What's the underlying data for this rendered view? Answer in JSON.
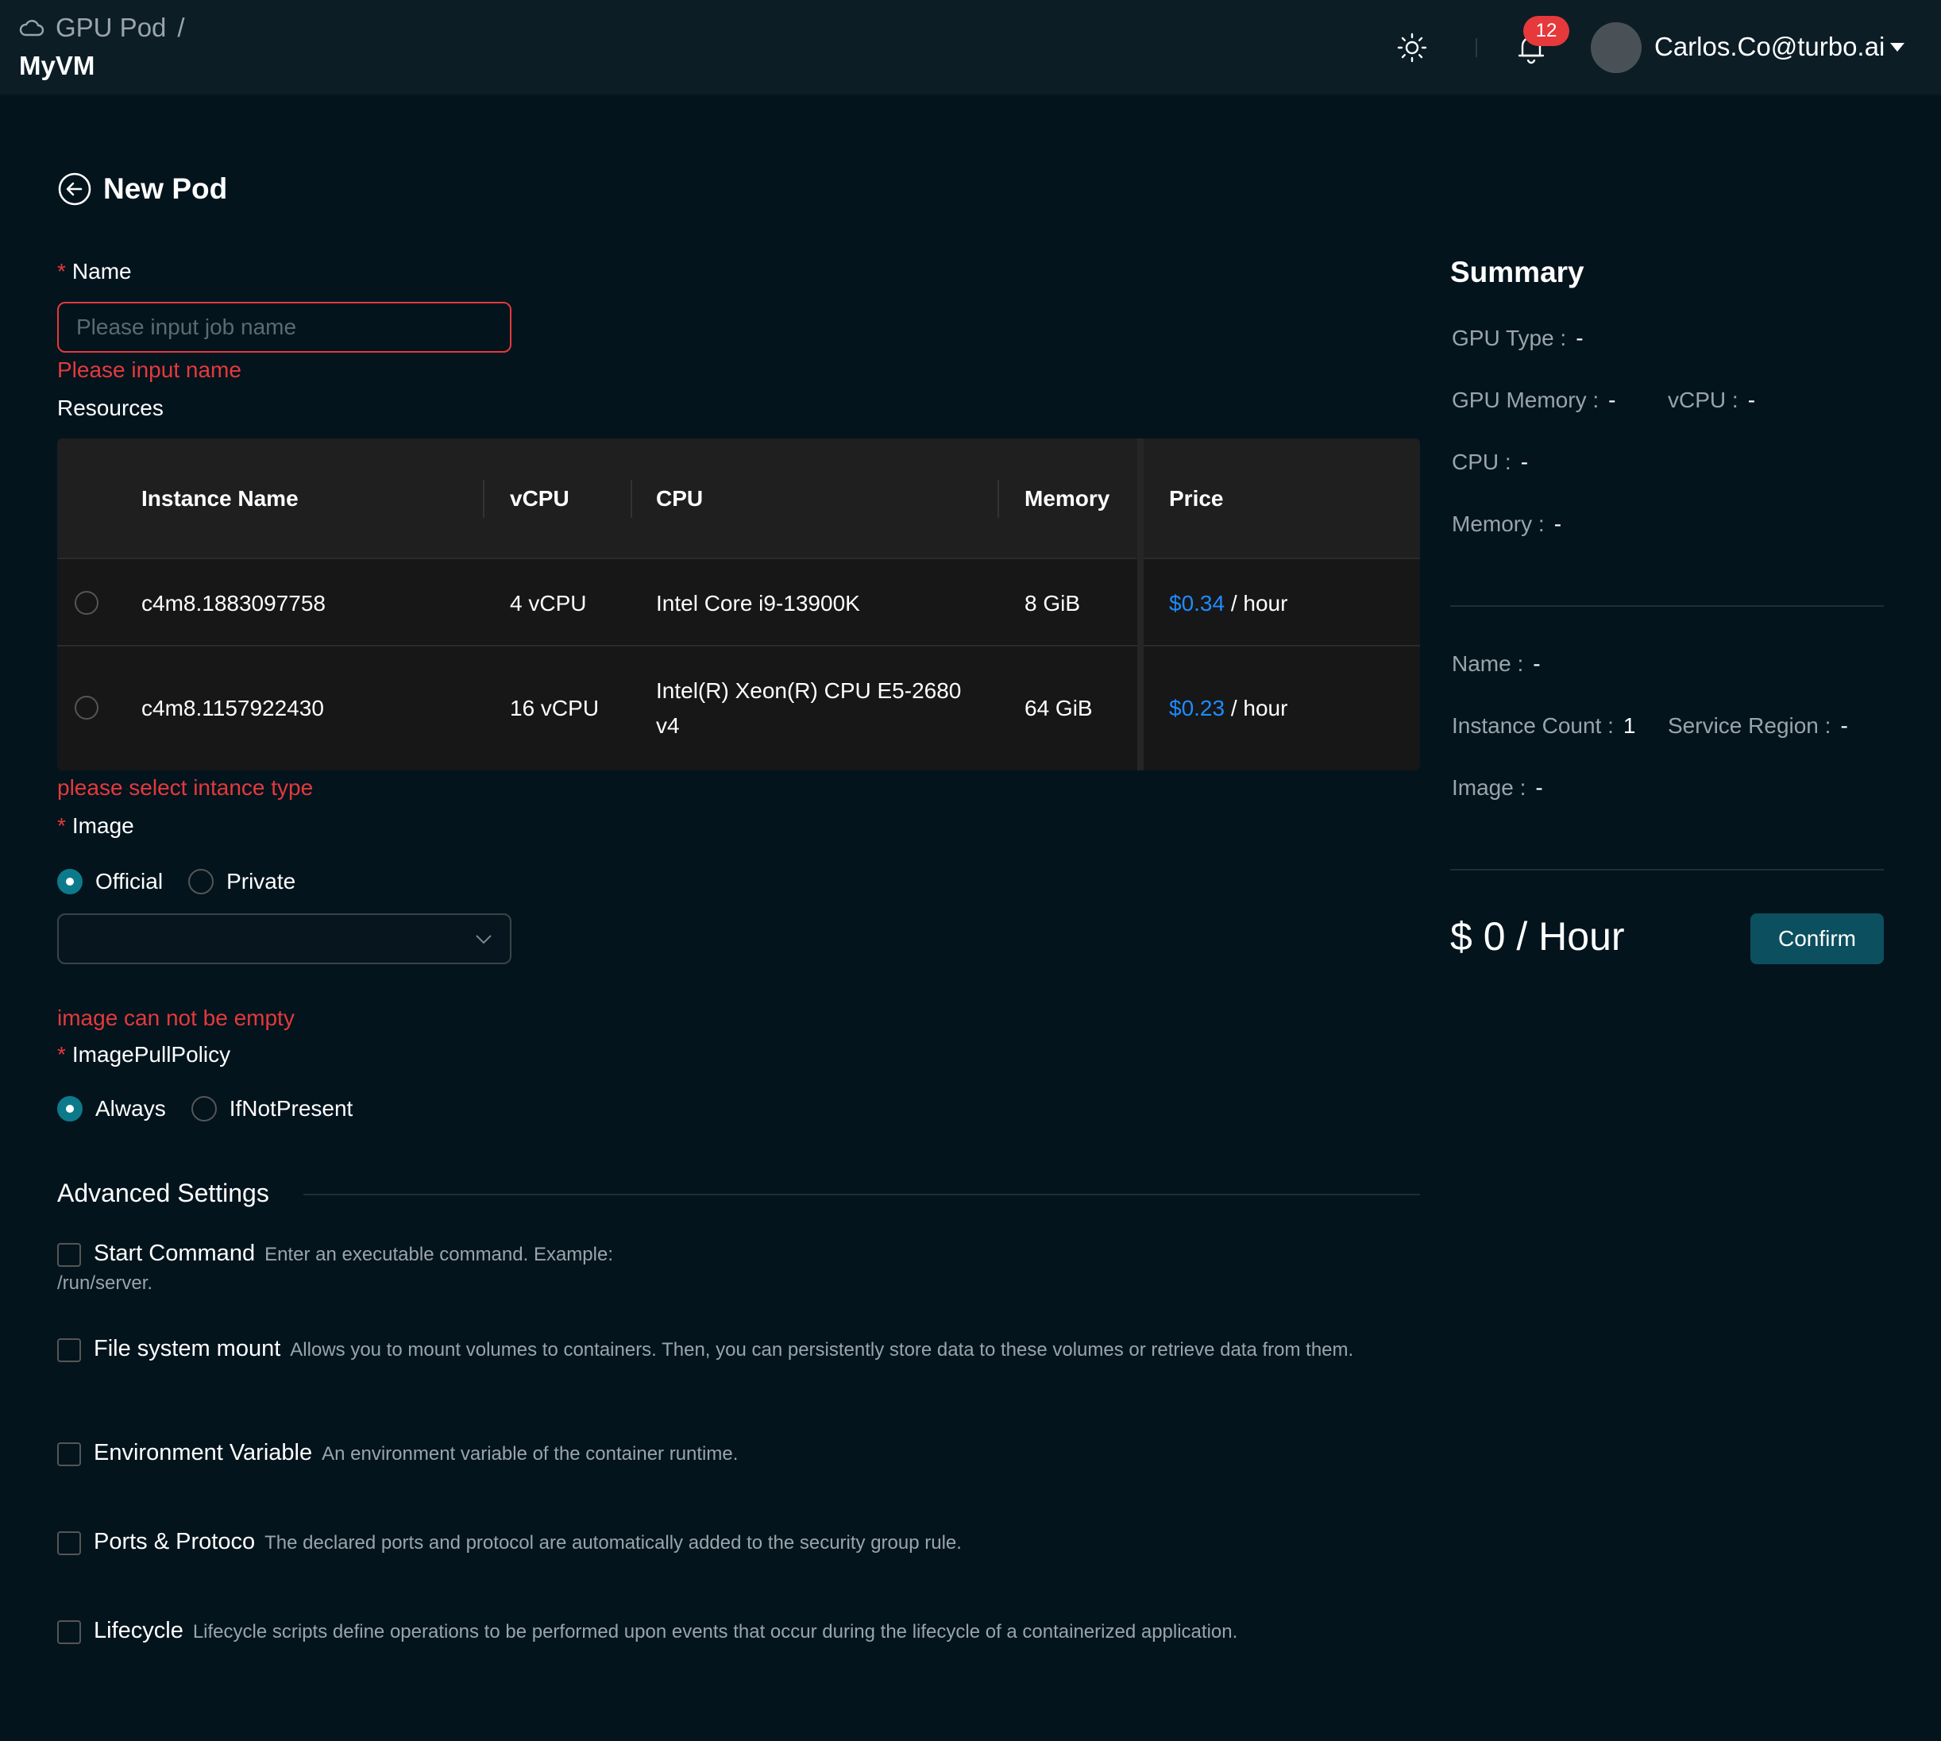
{
  "header": {
    "breadcrumb_root": "GPU Pod",
    "breadcrumb_sep": "/",
    "breadcrumb_current": "MyVM",
    "notifications_count": "12",
    "user_email": "Carlos.Co@turbo.ai"
  },
  "page": {
    "title": "New Pod"
  },
  "form": {
    "name_label": "Name",
    "name_placeholder": "Please input job name",
    "name_error": "Please input name",
    "resources_label": "Resources",
    "table": {
      "headers": [
        "Instance Name",
        "vCPU",
        "CPU",
        "Memory",
        "Price"
      ],
      "rows": [
        {
          "name": "c4m8.1883097758",
          "vcpu": "4 vCPU",
          "cpu": "Intel Core i9-13900K",
          "cpu2": "",
          "memory": "8 GiB",
          "price": "$0.34",
          "unit": " / hour"
        },
        {
          "name": "c4m8.1157922430",
          "vcpu": "16 vCPU",
          "cpu": "Intel(R) Xeon(R) CPU E5-2680",
          "cpu2": "v4",
          "memory": "64 GiB",
          "price": "$0.23",
          "unit": " / hour"
        }
      ]
    },
    "resources_error": "please select intance type",
    "image_label": "Image",
    "image_options": [
      "Official",
      "Private"
    ],
    "image_selected": "Official",
    "image_error": "image can not be empty",
    "pull_policy_label": "ImagePullPolicy",
    "pull_policy_options": [
      "Always",
      "IfNotPresent"
    ],
    "pull_policy_selected": "Always"
  },
  "advanced": {
    "title": "Advanced Settings",
    "items": [
      {
        "name": "Start Command",
        "desc": "Enter an executable command. Example: /run/server."
      },
      {
        "name": "File system mount",
        "desc": "Allows you to mount volumes to containers. Then, you can persistently store data to these volumes or retrieve data from them."
      },
      {
        "name": "Environment Variable",
        "desc": "An environment variable of the container runtime."
      },
      {
        "name": "Ports & Protoco",
        "desc": "The declared ports and protocol are automatically added to the security group rule."
      },
      {
        "name": "Lifecycle",
        "desc": "Lifecycle scripts define operations to be performed upon events that occur during the lifecycle of a containerized application."
      }
    ]
  },
  "summary": {
    "title": "Summary",
    "gpu_type_label": "GPU Type :",
    "gpu_type": "-",
    "gpu_memory_label": "GPU Memory :",
    "gpu_memory": "-",
    "vcpu_label": "vCPU :",
    "vcpu": "-",
    "cpu_label": "CPU :",
    "cpu": "-",
    "memory_label": "Memory :",
    "memory": "-",
    "name_label": "Name :",
    "name": "-",
    "instance_count_label": "Instance Count :",
    "instance_count": "1",
    "service_region_label": "Service Region :",
    "service_region": "-",
    "image_label": "Image :",
    "image": "-",
    "total": "$ 0 / Hour",
    "confirm_label": "Confirm"
  },
  "colors": {
    "background": "#03141d",
    "error": "#e5393c",
    "price": "#1e8bff",
    "accent": "#0c5060"
  }
}
